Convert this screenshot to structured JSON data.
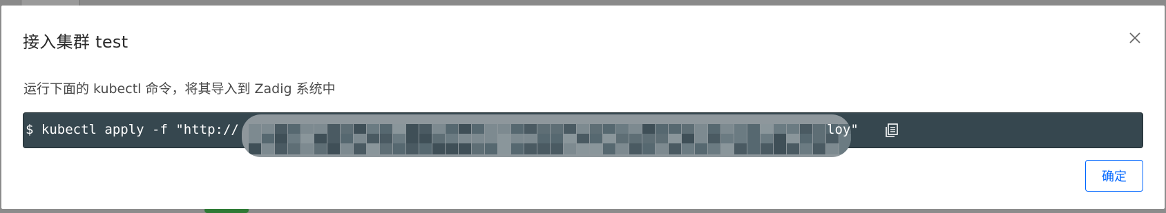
{
  "dialog": {
    "title": "接入集群 test",
    "instruction": "运行下面的 kubectl 命令，将其导入到 Zadig 系统中",
    "command_prefix": "$ kubectl apply -f \"http://",
    "command_suffix": "loy\"",
    "confirm_label": "确定",
    "icons": {
      "close": "close-icon",
      "copy": "copy-icon"
    },
    "colors": {
      "code_background": "#36474f",
      "accent": "#0066ff"
    }
  }
}
